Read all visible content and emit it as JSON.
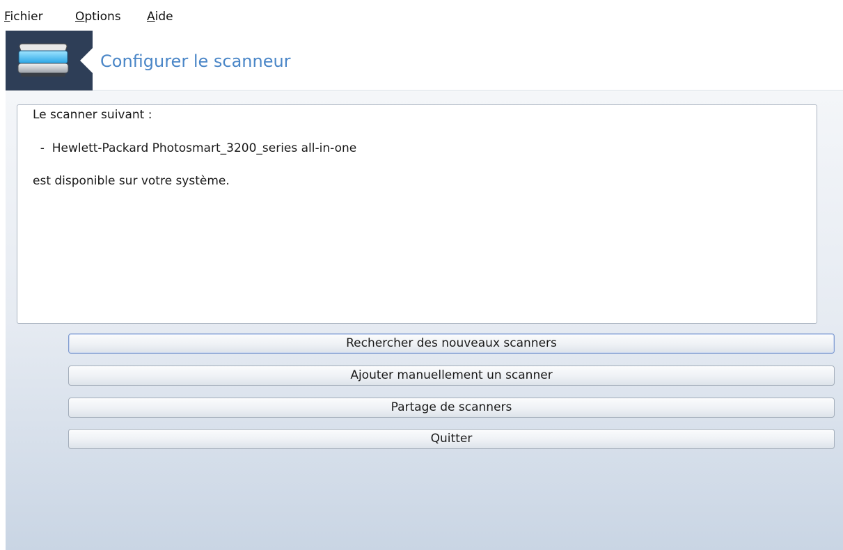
{
  "menubar": {
    "items": [
      {
        "mnemonic": "F",
        "rest": "ichier"
      },
      {
        "mnemonic": "O",
        "rest": "ptions"
      },
      {
        "mnemonic": "A",
        "rest": "ide"
      }
    ]
  },
  "header": {
    "icon": "scanner-icon",
    "title": "Configurer le scanneur"
  },
  "content": {
    "lines": [
      "Le scanner suivant :",
      "  -  Hewlett-Packard Photosmart_3200_series all-in-one",
      "est disponible sur votre système."
    ]
  },
  "buttons": [
    {
      "label": "Rechercher des nouveaux scanners"
    },
    {
      "label": "Ajouter manuellement un scanner"
    },
    {
      "label": "Partage de scanners"
    },
    {
      "label": "Quitter"
    }
  ],
  "colors": {
    "header_icon_bg": "#2e3e57",
    "title_color": "#4a86c7"
  }
}
